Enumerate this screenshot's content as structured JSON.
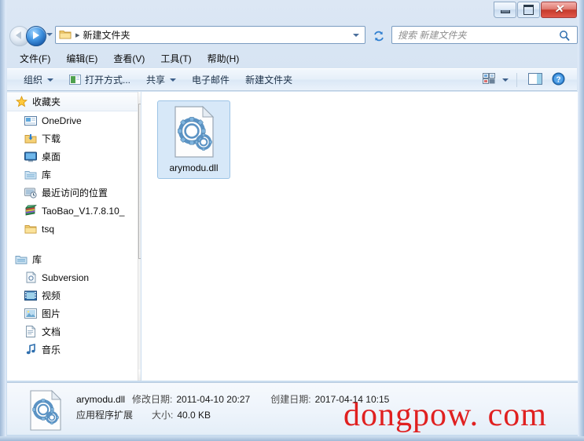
{
  "window": {
    "controls": {
      "minimize": "–",
      "maximize": "☐",
      "close": "✕"
    }
  },
  "addressbar": {
    "back_tooltip": "后退",
    "forward_tooltip": "前进",
    "breadcrumb": "新建文件夹",
    "separator": "▸",
    "refresh_tooltip": "刷新",
    "search_placeholder": "搜索 新建文件夹"
  },
  "menubar": {
    "items": [
      {
        "label": "文件(F)"
      },
      {
        "label": "编辑(E)"
      },
      {
        "label": "查看(V)"
      },
      {
        "label": "工具(T)"
      },
      {
        "label": "帮助(H)"
      }
    ]
  },
  "toolbar": {
    "organize": "组织",
    "open_with": "打开方式...",
    "share": "共享",
    "email": "电子邮件",
    "new_folder": "新建文件夹"
  },
  "navpane": {
    "favorites": {
      "label": "收藏夹",
      "items": [
        {
          "label": "OneDrive",
          "icon": "onedrive-icon"
        },
        {
          "label": "下载",
          "icon": "downloads-icon"
        },
        {
          "label": "桌面",
          "icon": "desktop-icon"
        },
        {
          "label": "库",
          "icon": "library-icon"
        },
        {
          "label": "最近访问的位置",
          "icon": "recent-places-icon"
        },
        {
          "label": "TaoBao_V1.7.8.10_",
          "icon": "archive-icon"
        },
        {
          "label": "tsq",
          "icon": "folder-icon"
        }
      ]
    },
    "libraries": {
      "label": "库",
      "items": [
        {
          "label": "Subversion",
          "icon": "subversion-icon"
        },
        {
          "label": "视频",
          "icon": "videos-icon"
        },
        {
          "label": "图片",
          "icon": "pictures-icon"
        },
        {
          "label": "文档",
          "icon": "documents-icon"
        },
        {
          "label": "音乐",
          "icon": "music-icon"
        }
      ]
    }
  },
  "filepane": {
    "items": [
      {
        "name": "arymodu.dll",
        "icon": "dll-icon",
        "selected": true
      }
    ]
  },
  "details": {
    "filename": "arymodu.dll",
    "modified_label": "修改日期:",
    "modified_value": "2011-04-10 20:27",
    "created_label": "创建日期:",
    "created_value": "2017-04-14 10:15",
    "filetype": "应用程序扩展",
    "size_label": "大小:",
    "size_value": "40.0 KB"
  },
  "watermark": {
    "text": "dongpow. com",
    "color": "#e02020"
  }
}
